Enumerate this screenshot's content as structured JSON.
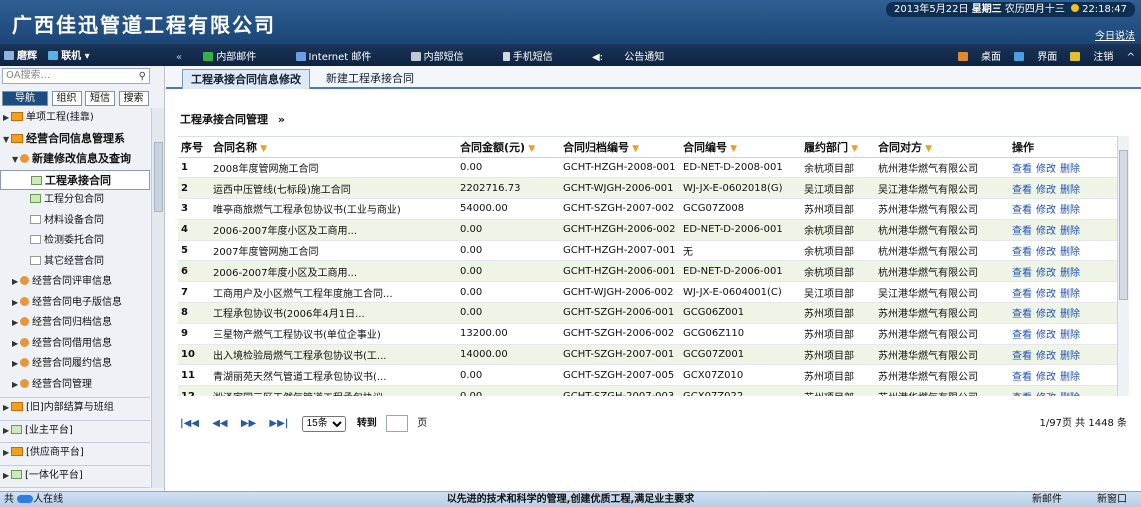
{
  "header": {
    "company": "广西佳迅管道工程有限公司",
    "date": "2013年5月22日",
    "weekday": "星期三",
    "lunar": "农历四月十三",
    "time": "22:18:47",
    "today_link": "今日说法"
  },
  "toolbar": {
    "user": "磨辉",
    "status": "联机 ▾",
    "menu": [
      "内部邮件",
      "Internet 邮件",
      "内部短信",
      "手机短信",
      "公告通知"
    ],
    "right": [
      "桌面",
      "界面",
      "注销"
    ]
  },
  "sidebar": {
    "search_placeholder": "OA搜索...",
    "tabs": [
      "导航",
      "组织",
      "短信",
      "搜索"
    ],
    "items": [
      {
        "label": "单项工程(挂靠)",
        "level": 0,
        "icon": "folder-icon"
      },
      {
        "label": "经营合同信息管理系",
        "level": 0,
        "icon": "folder-icon",
        "bold": true
      },
      {
        "label": "新建修改信息及查询",
        "level": 1,
        "icon": "dot-icon",
        "bold": true
      },
      {
        "label": "工程承接合同",
        "level": 2,
        "icon": "leaf-icon",
        "selected": true
      },
      {
        "label": "工程分包合同",
        "level": 2,
        "icon": "leaf-icon"
      },
      {
        "label": "材料设备合同",
        "level": 2,
        "icon": "doc-icon"
      },
      {
        "label": "检测委托合同",
        "level": 2,
        "icon": "doc-icon"
      },
      {
        "label": "其它经营合同",
        "level": 2,
        "icon": "doc-icon"
      },
      {
        "label": "经营合同评审信息",
        "level": 1,
        "icon": "dot-icon"
      },
      {
        "label": "经营合同电子版信息",
        "level": 1,
        "icon": "dot-icon"
      },
      {
        "label": "经营合同归档信息",
        "level": 1,
        "icon": "dot-icon"
      },
      {
        "label": "经营合同借用信息",
        "level": 1,
        "icon": "dot-icon"
      },
      {
        "label": "经营合同履约信息",
        "level": 1,
        "icon": "dot-icon"
      },
      {
        "label": "经营合同管理",
        "level": 1,
        "icon": "dot-icon"
      },
      {
        "label": "[旧]内部结算与班组",
        "level": 0,
        "icon": "folder-icon"
      },
      {
        "label": "[业主平台]",
        "level": 0,
        "icon": "leaf-icon"
      },
      {
        "label": "[供应商平台]",
        "level": 0,
        "icon": "folder-icon"
      },
      {
        "label": "[一体化平台]",
        "level": 0,
        "icon": "leaf-icon"
      },
      {
        "label": "菜单快捷组",
        "level": 0,
        "icon": "folder-icon"
      }
    ]
  },
  "page_tabs": [
    "工程承接合同信息修改",
    "新建工程承接合同"
  ],
  "section_title": "工程承接合同管理",
  "table": {
    "columns": [
      "序号",
      "合同名称",
      "合同金额(元)",
      "合同归档编号",
      "合同编号",
      "履约部门",
      "合同对方",
      "操作"
    ],
    "actions": [
      "查看",
      "修改",
      "删除"
    ],
    "rows": [
      [
        "1",
        "2008年度管网施工合同",
        "0.00",
        "GCHT-HZGH-2008-001",
        "ED-NET-D-2008-001",
        "余杭项目部",
        "杭州港华燃气有限公司"
      ],
      [
        "2",
        "运西中压管线(七标段)施工合同",
        "2202716.73",
        "GCHT-WJGH-2006-001",
        "WJ-JX-E-0602018(G)",
        "吴江项目部",
        "吴江港华燃气有限公司"
      ],
      [
        "3",
        "唯亭商旅燃气工程承包协议书(工业与商业)",
        "54000.00",
        "GCHT-SZGH-2007-002",
        "GCG07Z008",
        "苏州项目部",
        "苏州港华燃气有限公司"
      ],
      [
        "4",
        "2006-2007年度小区及工商用...",
        "0.00",
        "GCHT-HZGH-2006-002",
        "ED-NET-D-2006-001",
        "余杭项目部",
        "杭州港华燃气有限公司"
      ],
      [
        "5",
        "2007年度管网施工合同",
        "0.00",
        "GCHT-HZGH-2007-001",
        "无",
        "余杭项目部",
        "杭州港华燃气有限公司"
      ],
      [
        "6",
        "2006-2007年度小区及工商用...",
        "0.00",
        "GCHT-HZGH-2006-001",
        "ED-NET-D-2006-001",
        "余杭项目部",
        "杭州港华燃气有限公司"
      ],
      [
        "7",
        "工商用户及小区燃气工程年度施工合同...",
        "0.00",
        "GCHT-WJGH-2006-002",
        "WJ-JX-E-0604001(C)",
        "吴江项目部",
        "吴江港华燃气有限公司"
      ],
      [
        "8",
        "工程承包协议书(2006年4月1日...",
        "0.00",
        "GCHT-SZGH-2006-001",
        "GCG06Z001",
        "苏州项目部",
        "苏州港华燃气有限公司"
      ],
      [
        "9",
        "三星物产燃气工程协议书(单位企事业)",
        "13200.00",
        "GCHT-SZGH-2006-002",
        "GCG06Z110",
        "苏州项目部",
        "苏州港华燃气有限公司"
      ],
      [
        "10",
        "出入境检验局燃气工程承包协议书(工...",
        "14000.00",
        "GCHT-SZGH-2007-001",
        "GCG07Z001",
        "苏州项目部",
        "苏州港华燃气有限公司"
      ],
      [
        "11",
        "青湖丽苑天然气管道工程承包协议书(...",
        "0.00",
        "GCHT-SZGH-2007-005",
        "GCX07Z010",
        "苏州项目部",
        "苏州港华燃气有限公司"
      ],
      [
        "12",
        "淞泽家园三区天然气管道工程承包协议...",
        "0.00",
        "GCHT-SZGH-2007-003",
        "GCX07Z022",
        "苏州项目部",
        "苏州港华燃气有限公司"
      ]
    ]
  },
  "pager": {
    "page_size": "15条",
    "goto_label": "转到",
    "page_unit": "页",
    "summary": "1/97页 共 1448 条"
  },
  "statusbar": {
    "online": "人在线",
    "online_prefix": "共",
    "slogan": "以先进的技术和科学的管理,创建优质工程,满足业主要求",
    "new_mail": "新邮件",
    "new_window": "新窗口"
  }
}
